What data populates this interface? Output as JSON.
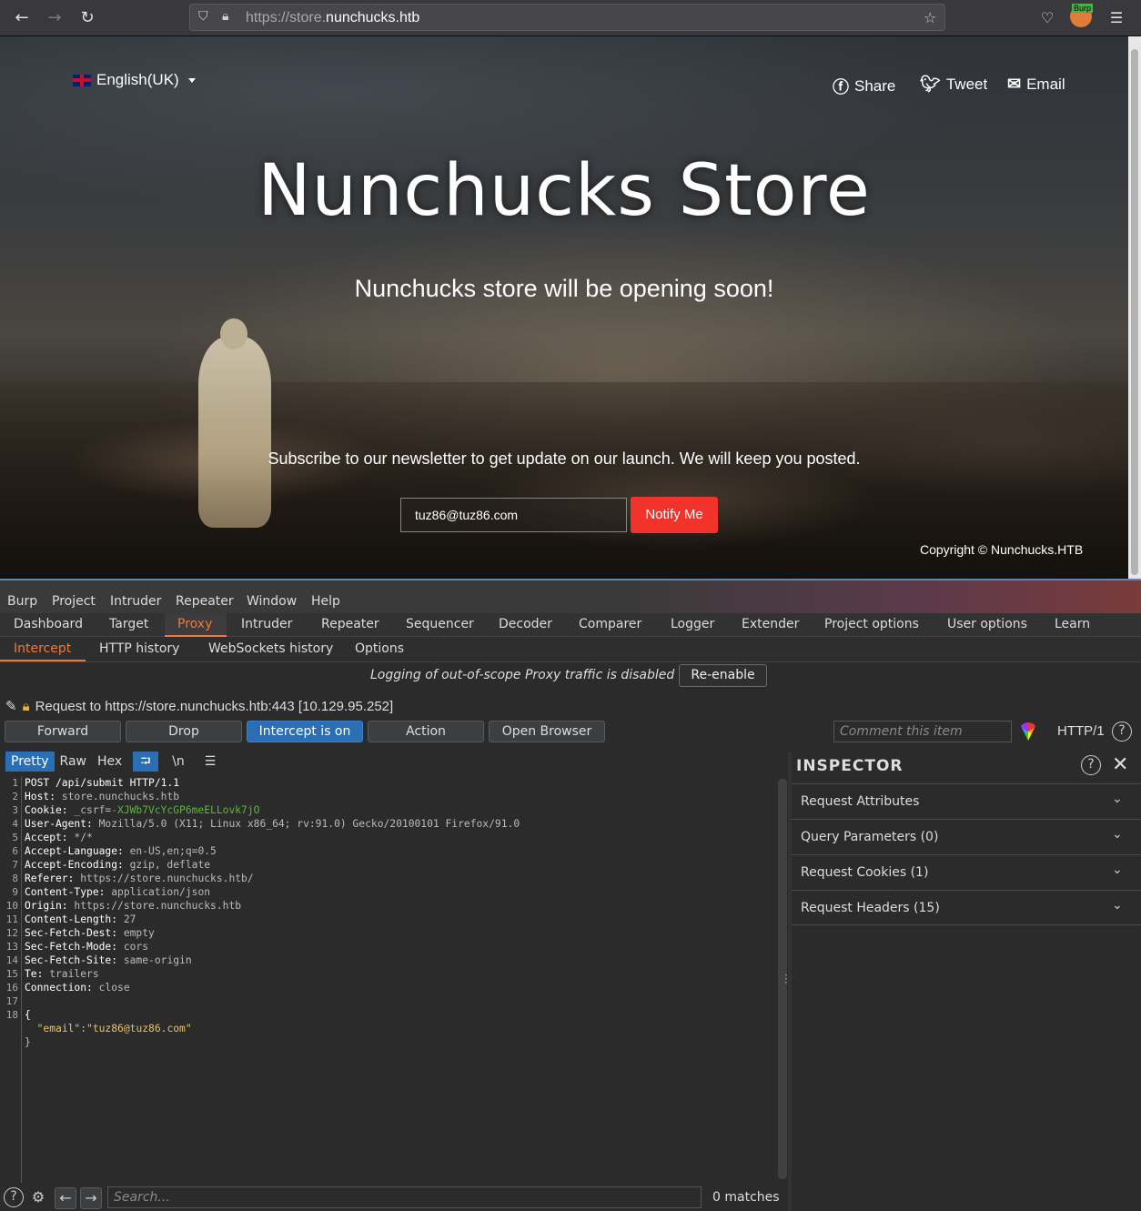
{
  "browser": {
    "url_scheme": "https://store.",
    "url_host": "nunchucks.htb",
    "burp_badge": "Burp"
  },
  "site": {
    "language": "English(UK)",
    "share": "Share",
    "tweet": "Tweet",
    "email": "Email",
    "title": "Nunchucks Store",
    "subtitle": "Nunchucks store will be opening soon!",
    "newsletter": "Subscribe to our newsletter to get update on our launch. We will keep you posted.",
    "email_value": "tuz86@tuz86.com",
    "notify": "Notify Me",
    "copyright": "Copyright © Nunchucks.HTB"
  },
  "burp": {
    "menu": [
      "Burp",
      "Project",
      "Intruder",
      "Repeater",
      "Window",
      "Help"
    ],
    "tabs": [
      "Dashboard",
      "Target",
      "Proxy",
      "Intruder",
      "Repeater",
      "Sequencer",
      "Decoder",
      "Comparer",
      "Logger",
      "Extender",
      "Project options",
      "User options",
      "Learn"
    ],
    "active_tab": "Proxy",
    "subtabs": [
      "Intercept",
      "HTTP history",
      "WebSockets history",
      "Options"
    ],
    "notice": "Logging of out-of-scope Proxy traffic is disabled",
    "reenable": "Re-enable",
    "request_to": "Request to https://store.nunchucks.htb:443  [10.129.95.252]",
    "buttons": {
      "forward": "Forward",
      "drop": "Drop",
      "intercept": "Intercept is on",
      "action": "Action",
      "open_browser": "Open Browser"
    },
    "comment_placeholder": "Comment this item",
    "http_version": "HTTP/1",
    "view_tabs": [
      "Pretty",
      "Raw",
      "Hex"
    ],
    "newline_toggle": "\\n",
    "request_lines": [
      {
        "k": "POST /api/submit HTTP/1.1",
        "v": ""
      },
      {
        "k": "Host:",
        "v": " store.nunchucks.htb"
      },
      {
        "k": "Cookie:",
        "v": " _csrf=",
        "g": "-XJWb7VcYcGP6meELLovk7jO"
      },
      {
        "k": "User-Agent:",
        "v": " Mozilla/5.0 (X11; Linux x86_64; rv:91.0) Gecko/20100101 Firefox/91.0"
      },
      {
        "k": "Accept:",
        "v": " */*"
      },
      {
        "k": "Accept-Language:",
        "v": " en-US,en;q=0.5"
      },
      {
        "k": "Accept-Encoding:",
        "v": " gzip, deflate"
      },
      {
        "k": "Referer:",
        "v": " https://store.nunchucks.htb/"
      },
      {
        "k": "Content-Type:",
        "v": " application/json"
      },
      {
        "k": "Origin:",
        "v": " https://store.nunchucks.htb"
      },
      {
        "k": "Content-Length:",
        "v": " 27"
      },
      {
        "k": "Sec-Fetch-Dest:",
        "v": " empty"
      },
      {
        "k": "Sec-Fetch-Mode:",
        "v": " cors"
      },
      {
        "k": "Sec-Fetch-Site:",
        "v": " same-origin"
      },
      {
        "k": "Te:",
        "v": " trailers"
      },
      {
        "k": "Connection:",
        "v": " close"
      },
      {
        "k": "",
        "v": ""
      },
      {
        "k": "{",
        "v": ""
      }
    ],
    "json_body_key": "\"email\"",
    "json_body_value": "\"tuz86@tuz86.com\"",
    "json_close": "}",
    "search_placeholder": "Search...",
    "matches": "0 matches",
    "inspector": {
      "title": "INSPECTOR",
      "sections": [
        "Request Attributes",
        "Query Parameters (0)",
        "Request Cookies (1)",
        "Request Headers (15)"
      ]
    }
  }
}
